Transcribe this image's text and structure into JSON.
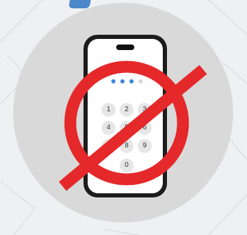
{
  "colors": {
    "background": "#eef0f3",
    "circle": "#d9d9d9",
    "phone_body": "#1c1c1c",
    "screen": "#ffffff",
    "pin_dot_filled": "#3d86d6",
    "pin_dot_empty": "#d6d6d6",
    "keypad_key": "#e6e6e6",
    "prohibition_sign": "#e5282a"
  },
  "icons": {
    "phone": "smartphone-icon",
    "prohibition": "prohibition-sign-icon"
  },
  "pin_indicator": {
    "entered": 3,
    "total": 4
  },
  "keypad": {
    "keys": [
      "1",
      "2",
      "3",
      "4",
      "5",
      "6",
      "7",
      "8",
      "9",
      "0"
    ]
  }
}
